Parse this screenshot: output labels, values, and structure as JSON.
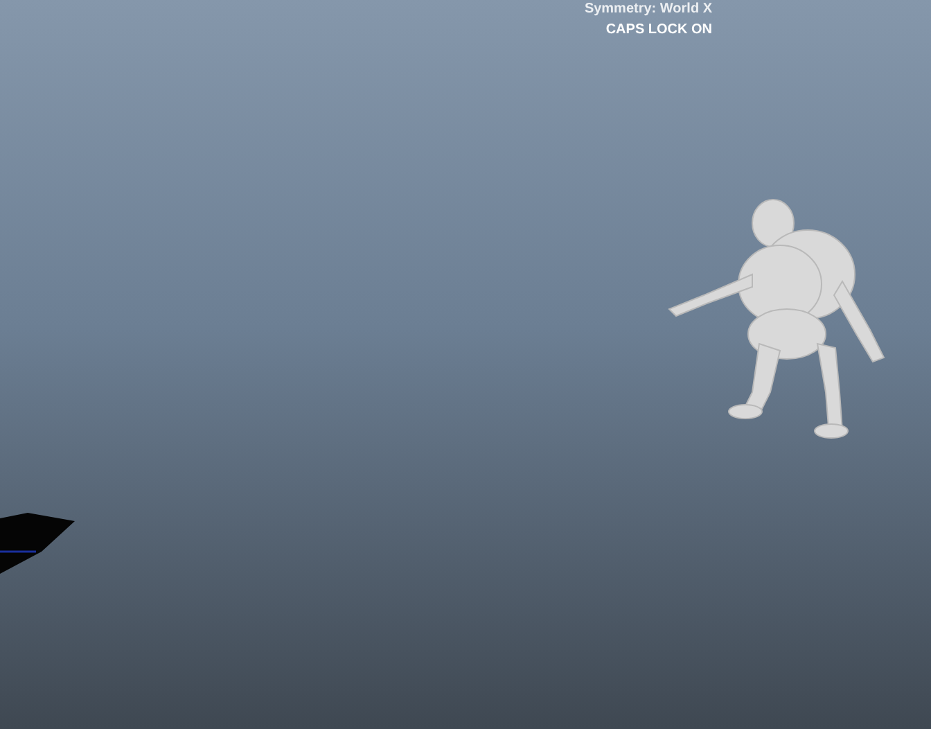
{
  "viewport": {
    "hud": [
      {
        "kind": "symmetry",
        "text": "Symmetry: World X"
      },
      {
        "kind": "caps",
        "text": "CAPS LOCK ON"
      }
    ]
  }
}
